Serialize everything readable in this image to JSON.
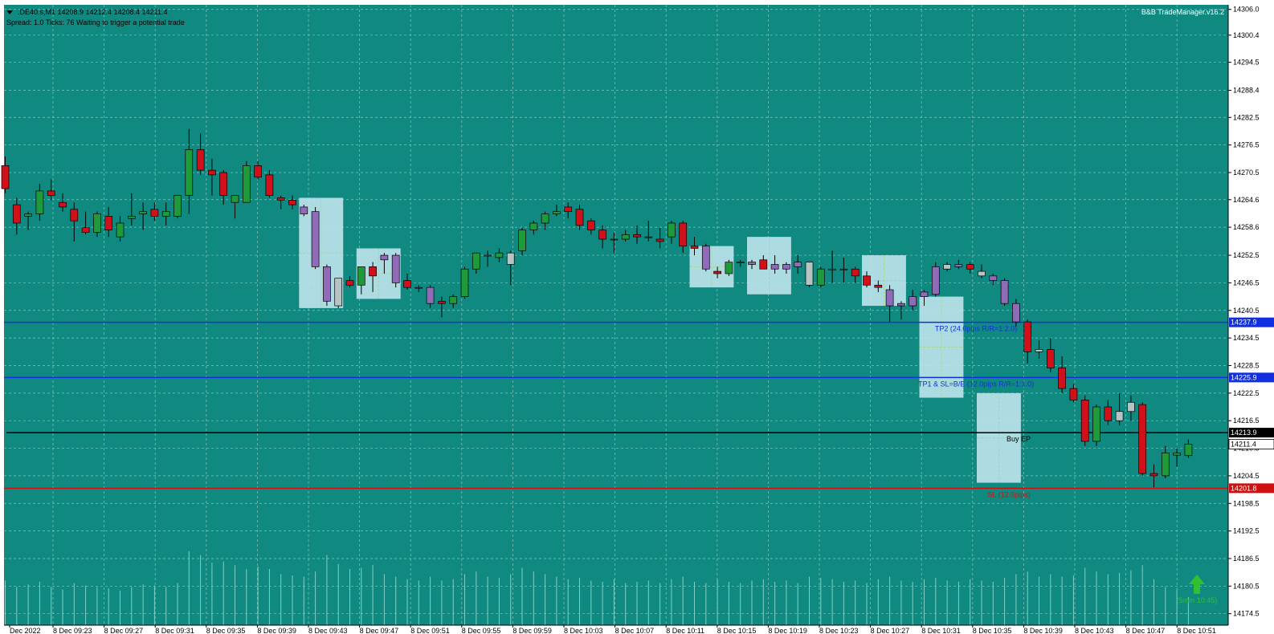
{
  "header": {
    "symbol_line": ".DE40.s,M1  14208.9 14212.4 14208.4 14211.4",
    "status_line": "Spread: 1.0  Ticks: 76  Waiting to trigger a potential trade",
    "brand": "B&B TradeManager.v16.2"
  },
  "colors": {
    "background": "#108A80",
    "grid": "#7FC8C0",
    "bull": "#1E9A3A",
    "bear": "#D0101A",
    "inside_bar": "#B8C4C4",
    "box": "#BFE3EC",
    "box_bar": "#8F6BB8",
    "tp_line": "#1030E0",
    "entry_line": "#000000",
    "sl_line": "#D01010",
    "arrow": "#30C030"
  },
  "chart_data": {
    "type": "candlestick",
    "symbol": ".DE40.s",
    "timeframe": "M1",
    "ylim": [
      14172.0,
      14307.0
    ],
    "y_ticks": [
      "14306.0",
      "14300.4",
      "14294.5",
      "14288.4",
      "14282.5",
      "14276.5",
      "14270.5",
      "14264.6",
      "14258.6",
      "14252.5",
      "14246.5",
      "14240.5",
      "14234.5",
      "14228.5",
      "14222.5",
      "14216.5",
      "14210.5",
      "14204.5",
      "14198.5",
      "14192.5",
      "14186.5",
      "14180.5",
      "14174.5"
    ],
    "x_tick_labels": [
      "Dec 2022",
      "8 Dec 09:23",
      "8 Dec 09:27",
      "8 Dec 09:31",
      "8 Dec 09:35",
      "8 Dec 09:39",
      "8 Dec 09:43",
      "8 Dec 09:47",
      "8 Dec 09:51",
      "8 Dec 09:55",
      "8 Dec 09:59",
      "8 Dec 10:03",
      "8 Dec 10:07",
      "8 Dec 10:11",
      "8 Dec 10:15",
      "8 Dec 10:19",
      "8 Dec 10:23",
      "8 Dec 10:27",
      "8 Dec 10:31",
      "8 Dec 10:35",
      "8 Dec 10:39",
      "8 Dec 10:43",
      "8 Dec 10:47",
      "8 Dec 10:51"
    ],
    "candles": [
      [
        14272.0,
        14274.0,
        14266.0,
        14267.0
      ],
      [
        14263.5,
        14265.0,
        14257.0,
        14259.5
      ],
      [
        14261.0,
        14262.0,
        14258.0,
        14261.5
      ],
      [
        14261.5,
        14268.0,
        14260.0,
        14266.5
      ],
      [
        14266.5,
        14269.0,
        14264.5,
        14265.5
      ],
      [
        14264.0,
        14266.0,
        14262.0,
        14263.0
      ],
      [
        14262.5,
        14264.0,
        14255.5,
        14260.0
      ],
      [
        14258.5,
        14262.0,
        14257.0,
        14257.5
      ],
      [
        14257.5,
        14262.0,
        14256.5,
        14261.5
      ],
      [
        14261.0,
        14263.0,
        14256.5,
        14258.0
      ],
      [
        14256.5,
        14261.0,
        14255.5,
        14259.5
      ],
      [
        14260.5,
        14266.0,
        14259.0,
        14261.0
      ],
      [
        14261.5,
        14264.0,
        14258.0,
        14262.0
      ],
      [
        14262.5,
        14264.0,
        14260.0,
        14261.0
      ],
      [
        14261.0,
        14264.0,
        14259.0,
        14262.0
      ],
      [
        14261.0,
        14265.0,
        14260.5,
        14265.5
      ],
      [
        14265.5,
        14280.0,
        14261.5,
        14275.5
      ],
      [
        14275.5,
        14279.0,
        14270.0,
        14271.0
      ],
      [
        14271.0,
        14273.5,
        14265.5,
        14270.0
      ],
      [
        14270.5,
        14271.0,
        14263.5,
        14265.5
      ],
      [
        14264.0,
        14265.0,
        14260.5,
        14265.5
      ],
      [
        14264.0,
        14273.0,
        14264.0,
        14272.0
      ],
      [
        14272.0,
        14273.0,
        14269.0,
        14269.5
      ],
      [
        14270.0,
        14271.0,
        14265.0,
        14265.5
      ],
      [
        14265.0,
        14265.5,
        14262.5,
        14264.5
      ],
      [
        14264.5,
        14265.5,
        14262.5,
        14263.5
      ],
      [
        14263.0,
        14263.5,
        14261.0,
        14261.5
      ],
      [
        14262.0,
        14263.0,
        14249.5,
        14250.0
      ],
      [
        14250.0,
        14250.5,
        14241.5,
        14242.5
      ],
      [
        14241.5,
        14247.5,
        14241.0,
        14247.5
      ],
      [
        14247.0,
        14248.0,
        14245.5,
        14246.0
      ],
      [
        14246.0,
        14250.0,
        14244.0,
        14250.0
      ],
      [
        14250.0,
        14251.0,
        14244.5,
        14248.0
      ],
      [
        14251.5,
        14253.0,
        14248.5,
        14252.5
      ],
      [
        14252.5,
        14253.0,
        14245.5,
        14246.5
      ],
      [
        14247.0,
        14248.5,
        14245.0,
        14245.5
      ],
      [
        14245.5,
        14246.0,
        14244.5,
        14245.5
      ],
      [
        14245.5,
        14246.0,
        14241.0,
        14242.0
      ],
      [
        14242.5,
        14243.5,
        14239.0,
        14242.0
      ],
      [
        14242.0,
        14244.0,
        14241.0,
        14243.5
      ],
      [
        14243.5,
        14250.0,
        14243.0,
        14249.5
      ],
      [
        14249.5,
        14253.0,
        14248.5,
        14253.0
      ],
      [
        14252.5,
        14253.5,
        14250.0,
        14252.5
      ],
      [
        14252.0,
        14254.0,
        14251.0,
        14253.0
      ],
      [
        14250.5,
        14253.5,
        14246.0,
        14253.0
      ],
      [
        14253.5,
        14258.5,
        14252.5,
        14258.0
      ],
      [
        14258.0,
        14260.0,
        14257.0,
        14259.5
      ],
      [
        14259.5,
        14262.0,
        14258.0,
        14261.5
      ],
      [
        14261.5,
        14263.5,
        14261.0,
        14262.0
      ],
      [
        14263.0,
        14264.0,
        14260.5,
        14262.0
      ],
      [
        14262.5,
        14263.5,
        14258.0,
        14259.0
      ],
      [
        14260.0,
        14260.5,
        14257.0,
        14258.0
      ],
      [
        14258.0,
        14259.0,
        14254.0,
        14256.0
      ],
      [
        14256.0,
        14257.5,
        14253.0,
        14256.0
      ],
      [
        14256.0,
        14258.0,
        14255.5,
        14257.0
      ],
      [
        14257.0,
        14259.0,
        14255.0,
        14256.5
      ],
      [
        14256.5,
        14260.0,
        14255.5,
        14256.5
      ],
      [
        14256.0,
        14258.5,
        14254.0,
        14255.5
      ],
      [
        14256.5,
        14260.0,
        14255.0,
        14259.5
      ],
      [
        14259.5,
        14260.0,
        14253.0,
        14254.5
      ],
      [
        14254.5,
        14256.5,
        14252.5,
        14254.0
      ],
      [
        14254.5,
        14255.0,
        14249.0,
        14249.5
      ],
      [
        14249.0,
        14250.0,
        14247.5,
        14248.5
      ],
      [
        14248.5,
        14251.5,
        14248.0,
        14251.0
      ],
      [
        14251.0,
        14251.5,
        14250.0,
        14251.0
      ],
      [
        14251.0,
        14251.5,
        14249.5,
        14250.5
      ],
      [
        14251.5,
        14252.5,
        14249.5,
        14249.5
      ],
      [
        14249.5,
        14252.5,
        14248.5,
        14250.5
      ],
      [
        14250.5,
        14251.0,
        14248.5,
        14249.5
      ],
      [
        14250.0,
        14252.5,
        14248.5,
        14251.0
      ],
      [
        14251.0,
        14251.0,
        14245.5,
        14246.0
      ],
      [
        14246.0,
        14250.0,
        14245.5,
        14249.5
      ],
      [
        14249.5,
        14253.5,
        14246.5,
        14249.5
      ],
      [
        14249.5,
        14252.0,
        14246.5,
        14249.5
      ],
      [
        14249.5,
        14250.0,
        14246.5,
        14248.0
      ],
      [
        14248.0,
        14249.0,
        14245.5,
        14246.0
      ],
      [
        14246.0,
        14247.0,
        14244.5,
        14245.5
      ],
      [
        14245.0,
        14246.0,
        14238.0,
        14241.5
      ],
      [
        14241.5,
        14242.5,
        14238.5,
        14242.0
      ],
      [
        14241.5,
        14245.0,
        14240.5,
        14243.5
      ],
      [
        14243.5,
        14245.0,
        14241.5,
        14244.5
      ],
      [
        14244.0,
        14251.0,
        14243.5,
        14250.0
      ],
      [
        14249.5,
        14251.0,
        14249.0,
        14250.5
      ],
      [
        14250.5,
        14251.5,
        14249.5,
        14250.0
      ],
      [
        14250.5,
        14251.0,
        14248.5,
        14249.5
      ],
      [
        14249.0,
        14250.5,
        14247.5,
        14248.0
      ],
      [
        14248.0,
        14248.5,
        14246.0,
        14247.0
      ],
      [
        14247.0,
        14247.5,
        14241.5,
        14242.0
      ],
      [
        14242.0,
        14243.0,
        14237.0,
        14238.0
      ],
      [
        14238.0,
        14238.5,
        14229.0,
        14231.5
      ],
      [
        14231.5,
        14234.0,
        14230.0,
        14232.0
      ],
      [
        14232.0,
        14234.5,
        14227.0,
        14228.0
      ],
      [
        14228.0,
        14230.5,
        14222.5,
        14223.5
      ],
      [
        14223.5,
        14224.5,
        14220.5,
        14221.0
      ],
      [
        14221.0,
        14222.0,
        14211.0,
        14212.0
      ],
      [
        14212.0,
        14220.0,
        14211.0,
        14219.5
      ],
      [
        14219.5,
        14221.0,
        14215.5,
        14216.5
      ],
      [
        14216.5,
        14222.5,
        14215.5,
        14218.5
      ],
      [
        14218.5,
        14222.0,
        14216.5,
        14220.5
      ],
      [
        14220.0,
        14220.5,
        14204.5,
        14205.0
      ],
      [
        14205.0,
        14207.0,
        14202.0,
        14204.5
      ],
      [
        14204.5,
        14211.0,
        14204.0,
        14209.5
      ],
      [
        14209.0,
        14210.5,
        14206.5,
        14209.5
      ],
      [
        14208.9,
        14212.4,
        14208.4,
        14211.4
      ]
    ],
    "volumes": [
      0.35,
      0.3,
      0.32,
      0.34,
      0.3,
      0.28,
      0.33,
      0.31,
      0.3,
      0.29,
      0.27,
      0.3,
      0.32,
      0.31,
      0.3,
      0.33,
      0.58,
      0.55,
      0.49,
      0.5,
      0.47,
      0.44,
      0.46,
      0.44,
      0.4,
      0.39,
      0.38,
      0.42,
      0.55,
      0.48,
      0.44,
      0.45,
      0.47,
      0.4,
      0.38,
      0.36,
      0.35,
      0.38,
      0.35,
      0.36,
      0.4,
      0.42,
      0.38,
      0.37,
      0.4,
      0.45,
      0.42,
      0.4,
      0.38,
      0.36,
      0.37,
      0.35,
      0.34,
      0.36,
      0.33,
      0.34,
      0.35,
      0.33,
      0.36,
      0.38,
      0.34,
      0.33,
      0.36,
      0.34,
      0.33,
      0.35,
      0.36,
      0.34,
      0.35,
      0.33,
      0.38,
      0.37,
      0.36,
      0.34,
      0.35,
      0.33,
      0.36,
      0.38,
      0.35,
      0.34,
      0.36,
      0.37,
      0.35,
      0.34,
      0.36,
      0.35,
      0.34,
      0.37,
      0.4,
      0.42,
      0.38,
      0.4,
      0.38,
      0.39,
      0.45,
      0.42,
      0.4,
      0.41,
      0.43,
      0.47,
      0.36,
      0.3,
      0.28,
      0.22
    ],
    "inside_bar_indices": [
      29,
      33,
      42,
      44,
      70,
      72,
      82,
      85,
      90,
      97,
      98
    ],
    "highlight_boxes": [
      {
        "from": 26,
        "to": 29,
        "top": 14265.0,
        "bottom": 14241.0
      },
      {
        "from": 31,
        "to": 34,
        "top": 14254.0,
        "bottom": 14243.0
      },
      {
        "from": 60,
        "to": 63,
        "top": 14254.5,
        "bottom": 14245.5
      },
      {
        "from": 65,
        "to": 68,
        "top": 14256.5,
        "bottom": 14244.0
      },
      {
        "from": 75,
        "to": 78,
        "top": 14252.5,
        "bottom": 14241.5
      },
      {
        "from": 80,
        "to": 83,
        "top": 14243.5,
        "bottom": 14221.5
      },
      {
        "from": 85,
        "to": 88,
        "top": 14222.5,
        "bottom": 14203.0
      }
    ],
    "box_bar_indices": [
      26,
      27,
      28,
      33,
      34,
      36,
      37,
      61,
      64,
      65,
      67,
      68,
      69,
      77,
      78,
      79,
      80,
      81,
      83,
      86,
      87,
      88
    ],
    "levels": [
      {
        "name": "TP2",
        "price": 14237.9,
        "tag": "14237.9",
        "label": "TP2 (24.0pips R/R=1:2.0)",
        "kind": "tp"
      },
      {
        "name": "TP1",
        "price": 14225.9,
        "tag": "14225.9",
        "label": "TP1 & SL=B/E (12.0pips R/R=1:1.0)",
        "kind": "tp"
      },
      {
        "name": "EP",
        "price": 14213.9,
        "tag": "14213.9",
        "label": "Buy EP",
        "kind": "entry"
      },
      {
        "name": "SL",
        "price": 14201.8,
        "tag": "14201.8",
        "label": "SL (12.0pips)",
        "kind": "sl"
      }
    ],
    "current_price": "14211.4",
    "timer_label": "(5min 10:45)"
  }
}
